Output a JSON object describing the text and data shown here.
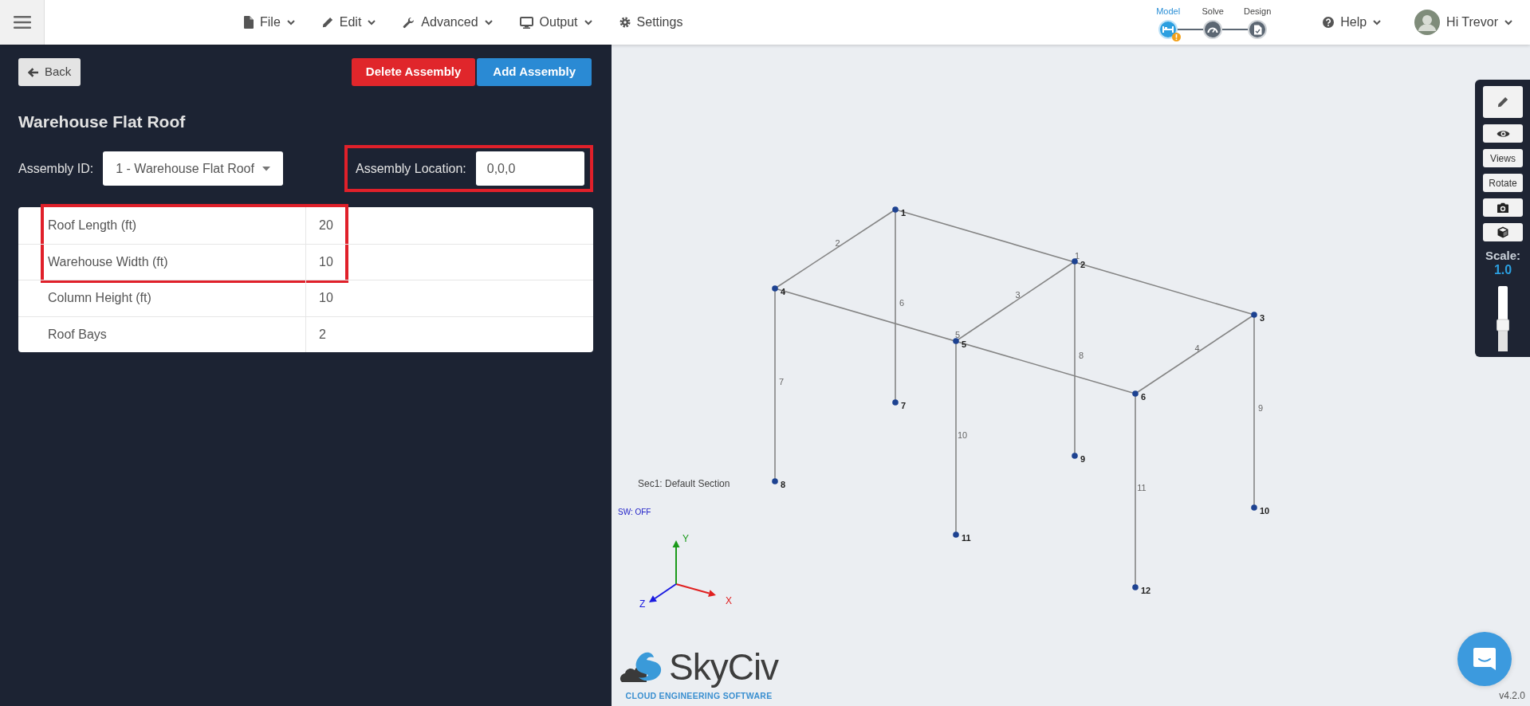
{
  "topbar": {
    "menu": [
      {
        "label": "File",
        "kind": "dropdown"
      },
      {
        "label": "Edit",
        "kind": "dropdown"
      },
      {
        "label": "Advanced",
        "kind": "dropdown"
      },
      {
        "label": "Output",
        "kind": "dropdown"
      },
      {
        "label": "Settings",
        "kind": "link"
      }
    ],
    "steps": [
      {
        "label": "Model",
        "selected": true,
        "warning": true
      },
      {
        "label": "Solve",
        "selected": false,
        "warning": false
      },
      {
        "label": "Design",
        "selected": false,
        "warning": false
      }
    ],
    "help": "Help",
    "user": "Hi Trevor"
  },
  "panel": {
    "back": "Back",
    "delete": "Delete Assembly",
    "add": "Add Assembly",
    "title": "Warehouse Flat Roof",
    "assembly_id": {
      "label": "Assembly ID:",
      "value": "1 - Warehouse Flat Roof"
    },
    "assembly_location": {
      "label": "Assembly Location:",
      "value": "0,0,0",
      "highlighted": true
    },
    "table": {
      "rows": [
        {
          "label": "Roof Length (ft)",
          "value": "20",
          "highlighted": true
        },
        {
          "label": "Warehouse Width (ft)",
          "value": "10",
          "highlighted": true
        },
        {
          "label": "Column Height (ft)",
          "value": "10",
          "highlighted": false
        },
        {
          "label": "Roof Bays",
          "value": "2",
          "highlighted": false
        }
      ]
    }
  },
  "canvas": {
    "nodes": [
      "1",
      "2",
      "3",
      "4",
      "5",
      "6",
      "7",
      "8",
      "9",
      "10",
      "11",
      "12"
    ],
    "members": [
      "1",
      "2",
      "3",
      "4",
      "5",
      "6",
      "7",
      "8",
      "9",
      "10",
      "11"
    ],
    "section_label": "Sec1: Default Section",
    "self_weight": "SW: OFF",
    "axes": [
      "X",
      "Y",
      "Z"
    ],
    "logo": {
      "name": "SkyCiv",
      "tagline": "CLOUD ENGINEERING SOFTWARE"
    },
    "version": "v4.2.0"
  },
  "toolbar": {
    "items": [
      {
        "kind": "icon"
      },
      {
        "kind": "icon"
      },
      {
        "kind": "text",
        "label": "Views"
      },
      {
        "kind": "text",
        "label": "Rotate"
      },
      {
        "kind": "icon"
      },
      {
        "kind": "icon"
      }
    ],
    "scale_label": "Scale:",
    "scale_value": "1.0",
    "slider": {
      "level": 0.4
    }
  }
}
